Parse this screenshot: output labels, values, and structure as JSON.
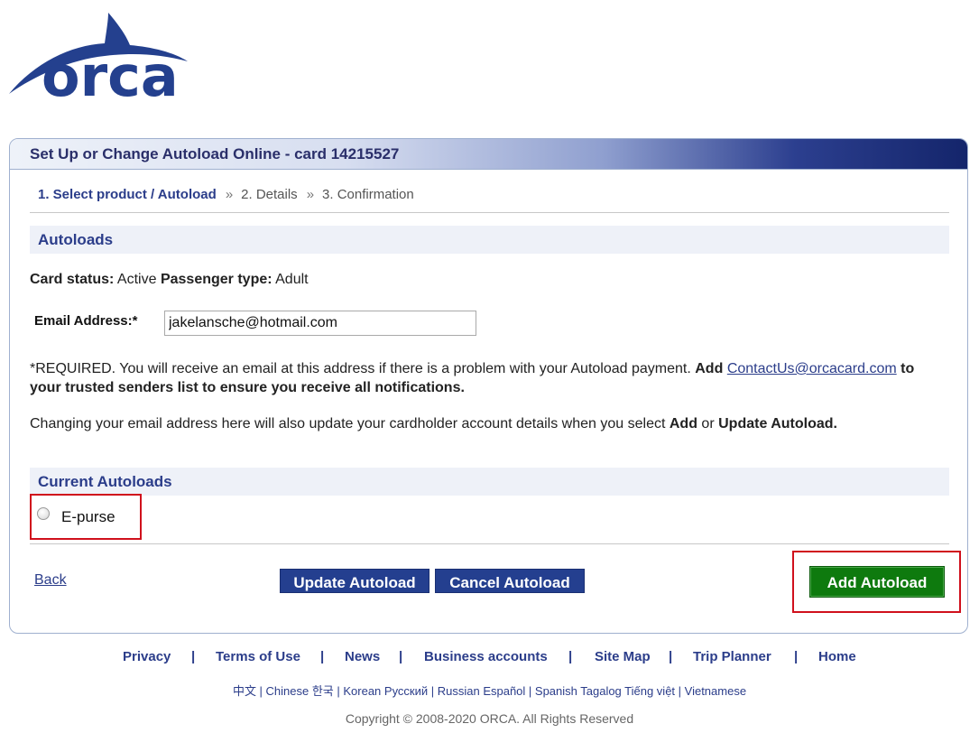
{
  "logo": {
    "text": "orca",
    "colors": {
      "primary": "#24408e"
    }
  },
  "panel": {
    "title": "Set Up or Change Autoload Online - card 14215527",
    "steps": [
      {
        "label": "1. Select product / Autoload",
        "active": true
      },
      {
        "label": "2. Details",
        "active": false
      },
      {
        "label": "3. Confirmation",
        "active": false
      }
    ],
    "step_separator": "»",
    "autoloads_heading": "Autoloads",
    "card_status_label": "Card status:",
    "card_status_value": "Active",
    "passenger_type_label": "Passenger type:",
    "passenger_type_value": "Adult",
    "email_label": "Email Address:*",
    "email_value": "jakelansche@hotmail.com",
    "required_text": "*REQUIRED. You will receive an email at this address if there is a problem with your Autoload payment.",
    "add_text": "Add",
    "contact_link": "ContactUs@orcacard.com",
    "trusted_text": "to your trusted senders list to ensure you receive all notifications.",
    "changing_text": "Changing your email address here will also update your cardholder account details when you select",
    "changing_add": "Add",
    "changing_or": "or",
    "changing_update": "Update Autoload.",
    "current_autoloads_heading": "Current Autoloads",
    "autoload_option": "E-purse",
    "back_link": "Back",
    "update_button": "Update Autoload",
    "cancel_button": "Cancel Autoload",
    "add_button": "Add Autoload"
  },
  "footer": {
    "links": [
      "Privacy",
      "Terms of Use",
      "News",
      "Business accounts",
      "Site Map",
      "Trip Planner",
      "Home"
    ],
    "languages": "中文 | Chinese 한국 | Korean Русский | Russian Español | Spanish Tagalog Tiếng việt | Vietnamese",
    "copyright": "Copyright © 2008-2020 ORCA. All Rights Reserved"
  },
  "colors": {
    "brand_blue": "#24408e",
    "heading_blue": "#2b3d8a",
    "add_green": "#0e7a0e",
    "highlight_red": "#d0101c"
  }
}
